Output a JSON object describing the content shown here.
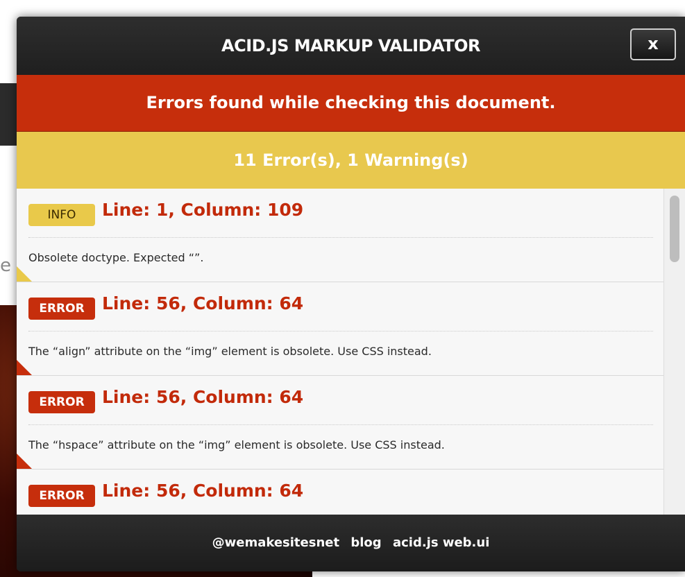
{
  "dialog": {
    "title": "ACID.JS MARKUP VALIDATOR",
    "close_label": "x",
    "error_banner": "Errors found while checking this document.",
    "summary": "11 Error(s), 1 Warning(s)"
  },
  "results": [
    {
      "type": "INFO",
      "location": "Line: 1, Column: 109",
      "message": "Obsolete doctype. Expected “”."
    },
    {
      "type": "ERROR",
      "location": "Line: 56, Column: 64",
      "message": "The “align” attribute on the “img” element is obsolete. Use CSS instead."
    },
    {
      "type": "ERROR",
      "location": "Line: 56, Column: 64",
      "message": "The “hspace” attribute on the “img” element is obsolete. Use CSS instead."
    },
    {
      "type": "ERROR",
      "location": "Line: 56, Column: 64",
      "message": ""
    }
  ],
  "footer": {
    "links": [
      "@wemakesitesnet",
      "blog",
      "acid.js web.ui"
    ]
  },
  "colors": {
    "error_red": "#c62e0c",
    "warning_yellow": "#e8c84e",
    "dark_chrome": "#2a2a2a"
  },
  "background": {
    "partial_char": "e"
  }
}
